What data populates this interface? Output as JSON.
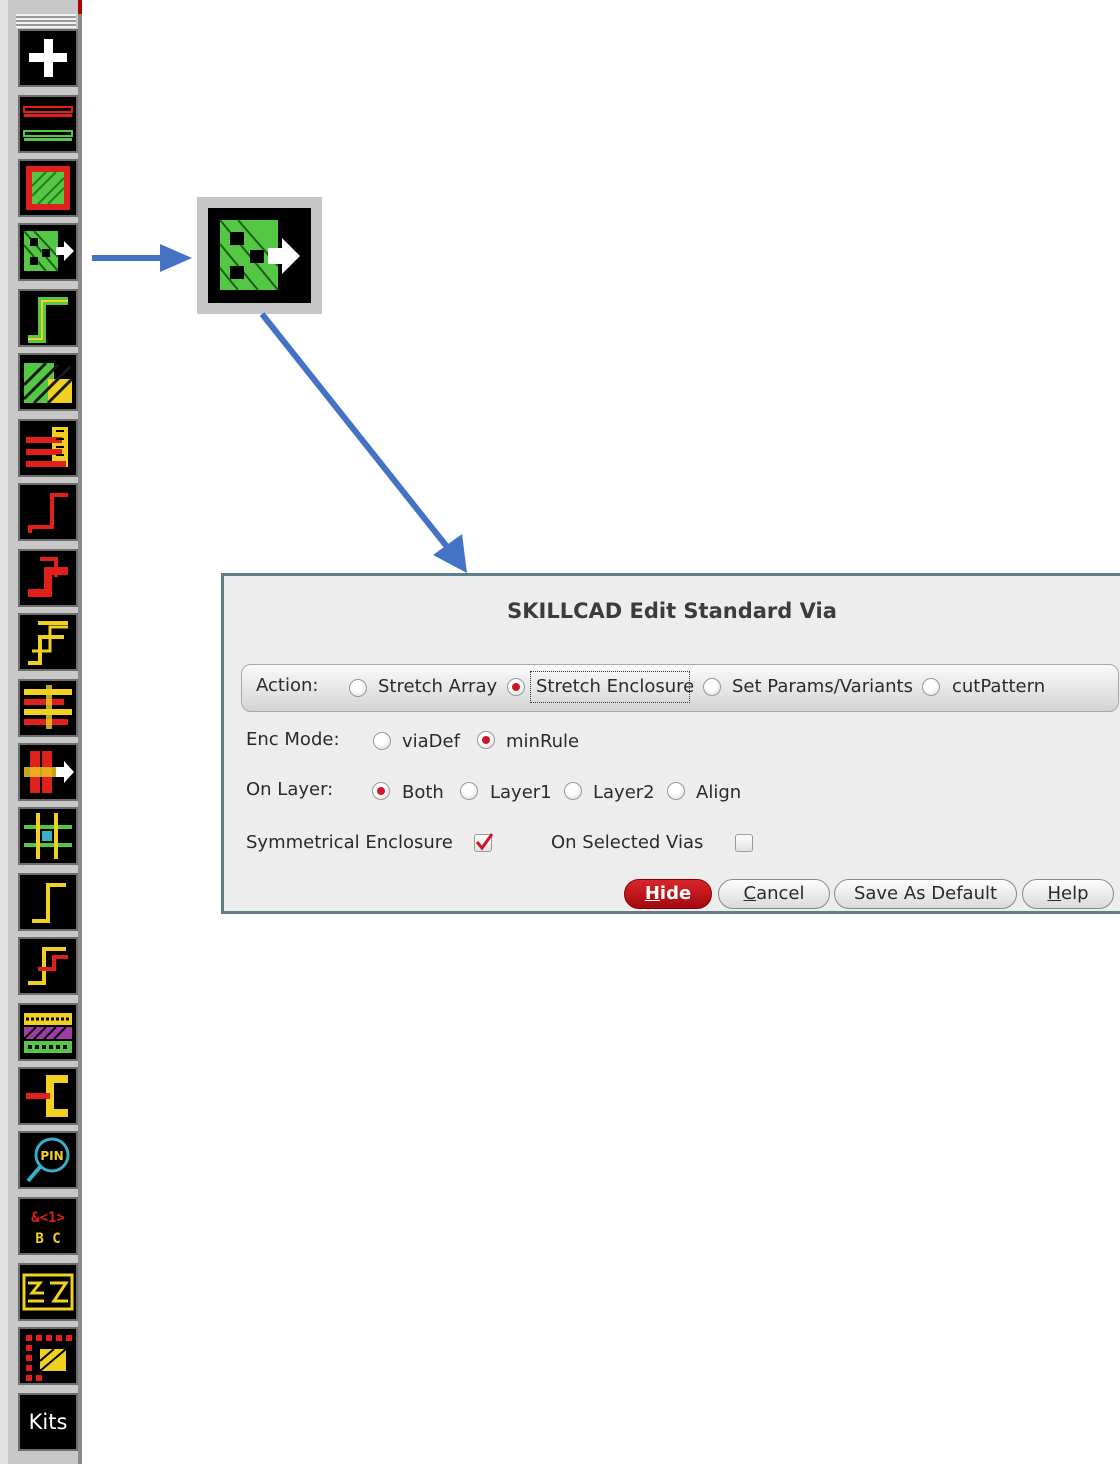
{
  "toolbar": {
    "buttons": [
      {
        "name": "add-icon"
      },
      {
        "name": "layer-lines-icon"
      },
      {
        "name": "fill-box-icon"
      },
      {
        "name": "via-stretch-icon"
      },
      {
        "name": "step-wire-icon"
      },
      {
        "name": "hatched-area-icon"
      },
      {
        "name": "bus-stack-icon"
      },
      {
        "name": "corner-wire-icon"
      },
      {
        "name": "zigzag-wire-icon"
      },
      {
        "name": "double-step-icon"
      },
      {
        "name": "bus-bars-icon"
      },
      {
        "name": "via-move-icon"
      },
      {
        "name": "cross-grid-icon"
      },
      {
        "name": "single-corner-icon"
      },
      {
        "name": "step-corner-icon"
      },
      {
        "name": "pattern-fill-icon"
      },
      {
        "name": "connector-icon"
      },
      {
        "name": "pin-search-icon"
      },
      {
        "name": "bus-rename-icon"
      },
      {
        "name": "zigzag-fill-icon"
      },
      {
        "name": "via-grid-icon"
      },
      {
        "name": "kits-button"
      }
    ],
    "bus_rename": {
      "top": "&<1>",
      "bottom": "B C"
    },
    "pin_label": "PIN",
    "kits_label": "Kits"
  },
  "zoom": {
    "icon": "via-stretch-icon"
  },
  "dialog": {
    "title": "SKILLCAD Edit Standard Via",
    "action": {
      "label": "Action:",
      "options": [
        {
          "label": "Stretch Array",
          "selected": false
        },
        {
          "label": "Stretch Enclosure",
          "selected": true
        },
        {
          "label": "Set Params/Variants",
          "selected": false
        },
        {
          "label": "cutPattern",
          "selected": false
        }
      ]
    },
    "enc_mode": {
      "label": "Enc Mode:",
      "options": [
        {
          "label": "viaDef",
          "selected": false
        },
        {
          "label": "minRule",
          "selected": true
        }
      ]
    },
    "on_layer": {
      "label": "On Layer:",
      "options": [
        {
          "label": "Both",
          "selected": true
        },
        {
          "label": "Layer1",
          "selected": false
        },
        {
          "label": "Layer2",
          "selected": false
        },
        {
          "label": "Align",
          "selected": false
        }
      ]
    },
    "symmetrical": {
      "label": "Symmetrical Enclosure",
      "checked": true
    },
    "selected_vias": {
      "label": "On Selected Vias",
      "checked": false
    },
    "buttons": {
      "hide": {
        "mnemonic": "H",
        "rest": "ide"
      },
      "cancel": {
        "mnemonic": "C",
        "rest": "ancel"
      },
      "save_default": "Save As Default",
      "help": {
        "mnemonic": "H",
        "rest": "elp"
      }
    }
  },
  "colors": {
    "arrow": "#4472c4",
    "accent": "#d0142a",
    "layer_green": "#54c845",
    "layer_red": "#e0201a",
    "layer_yellow": "#f0d020"
  }
}
